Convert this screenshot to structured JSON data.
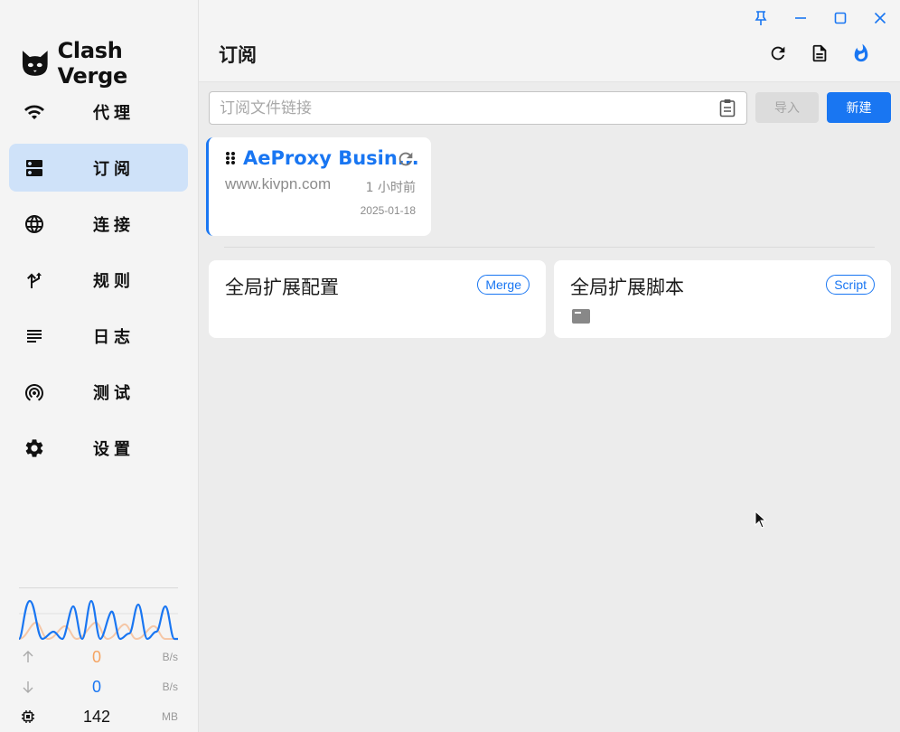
{
  "app": {
    "name": "Clash Verge"
  },
  "sidebar": {
    "items": [
      {
        "label": "代理",
        "icon": "wifi-icon"
      },
      {
        "label": "订阅",
        "icon": "dns-icon",
        "active": true
      },
      {
        "label": "连接",
        "icon": "globe-icon"
      },
      {
        "label": "规则",
        "icon": "fork-icon"
      },
      {
        "label": "日志",
        "icon": "subject-icon"
      },
      {
        "label": "测试",
        "icon": "wifi-tethering-icon"
      },
      {
        "label": "设置",
        "icon": "gear-icon"
      }
    ]
  },
  "traffic": {
    "upload": {
      "value": "0",
      "unit": "B/s",
      "color": "#f5a462"
    },
    "download": {
      "value": "0",
      "unit": "B/s",
      "color": "#1976f2"
    },
    "memory": {
      "value": "142",
      "unit": "MB"
    }
  },
  "header": {
    "title": "订阅"
  },
  "toolbar": {
    "url_placeholder": "订阅文件链接",
    "import_label": "导入",
    "new_label": "新建"
  },
  "profile": {
    "name": "AeProxy Busin...",
    "host": "www.kivpn.com",
    "updated": "1 小时前",
    "date": "2025-01-18"
  },
  "extensions": [
    {
      "title": "全局扩展配置",
      "badge": "Merge"
    },
    {
      "title": "全局扩展脚本",
      "badge": "Script"
    }
  ],
  "colors": {
    "accent": "#1976f2",
    "active_bg": "#cfe2f9"
  }
}
